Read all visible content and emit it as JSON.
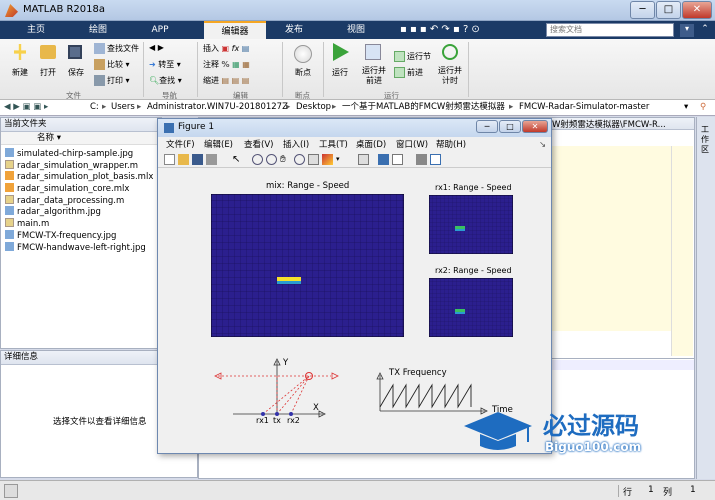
{
  "window": {
    "title": "MATLAB R2018a",
    "minimize": "─",
    "maximize": "□",
    "close": "✕"
  },
  "tabs": [
    "主页",
    "绘图",
    "APP",
    "编辑器",
    "发布",
    "视图"
  ],
  "search_placeholder": "搜索文档",
  "ribbon": {
    "new": "新建",
    "open": "打开",
    "save": "保存",
    "find_files": "查找文件",
    "compare": "比较",
    "print": "打印",
    "goto": "转至",
    "find": "查找",
    "insert": "插入",
    "comment": "注释",
    "indent": "缩进",
    "breakpoints": "断点",
    "run": "运行",
    "run_advance": "运行并\n前进",
    "run_section": "运行节",
    "advance": "前进",
    "run_time": "运行并\n计时",
    "groups": {
      "file": "文件",
      "nav": "导航",
      "edit": "编辑",
      "breakpoints": "断点",
      "run": "运行"
    }
  },
  "address": {
    "drive": "C:",
    "segments": [
      "Users",
      "Administrator.WIN7U-20180127Z",
      "Desktop",
      "一个基于MATLAB的FMCW射频雷达模拟器",
      "FMCW-Radar-Simulator-master"
    ]
  },
  "file_panel": {
    "title": "当前文件夹",
    "column": "名称 ▾",
    "files": [
      "simulated-chirp-sample.jpg",
      "radar_simulation_wrapper.m",
      "radar_simulation_plot_basis.mlx",
      "radar_simulation_core.mlx",
      "radar_data_processing.m",
      "radar_algorithm.jpg",
      "main.m",
      "FMCW-TX-frequency.jpg",
      "FMCW-handwave-left-right.jpg"
    ]
  },
  "details": {
    "title": "详细信息",
    "hint": "选择文件以查看详细信息"
  },
  "editor_path": "W射频雷达模拟器\\FMCW-R...",
  "workspace_label": "工作区",
  "figure": {
    "title": "Figure 1",
    "menu": [
      "文件(F)",
      "编辑(E)",
      "查看(V)",
      "插入(I)",
      "工具(T)",
      "桌面(D)",
      "窗口(W)",
      "帮助(H)"
    ],
    "plots": {
      "mix": "mix: Range - Speed",
      "rx1": "rx1: Range - Speed",
      "rx2": "rx2: Range - Speed"
    },
    "diagram": {
      "y": "Y",
      "x": "X",
      "rx1": "rx1",
      "tx": "tx",
      "rx2": "rx2"
    },
    "tx_plot": {
      "title": "TX Frequency",
      "xlabel": "Time"
    }
  },
  "watermark": {
    "brand": "必过源码",
    "site": "Biguo100.com"
  },
  "status": {
    "row_label": "行",
    "row": "1",
    "col_label": "列",
    "col": "1"
  },
  "colors": {
    "titlebar": "#c9daf0",
    "tabbar": "#1b3a66",
    "heatmap_bg": "#2a1f8a",
    "accent": "#f5a623"
  }
}
